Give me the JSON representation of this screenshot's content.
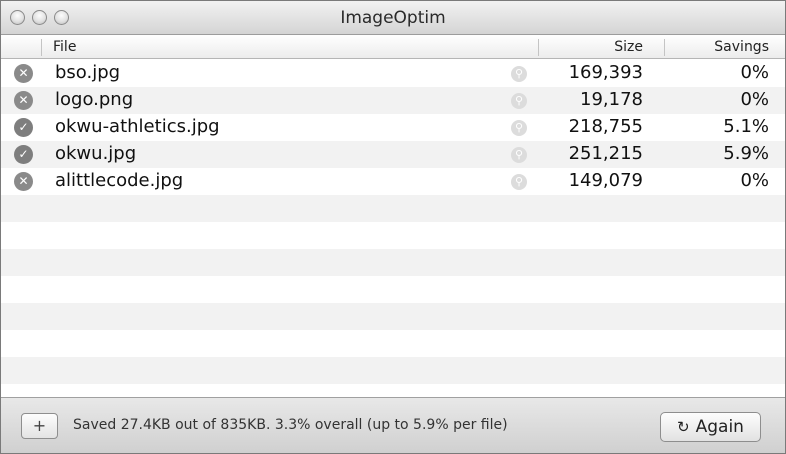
{
  "window": {
    "title": "ImageOptim"
  },
  "columns": {
    "file": "File",
    "size": "Size",
    "savings": "Savings"
  },
  "files": [
    {
      "name": "bso.jpg",
      "size": "169,393",
      "savings": "0%",
      "status": "error"
    },
    {
      "name": "logo.png",
      "size": "19,178",
      "savings": "0%",
      "status": "error"
    },
    {
      "name": "okwu-athletics.jpg",
      "size": "218,755",
      "savings": "5.1%",
      "status": "ok"
    },
    {
      "name": "okwu.jpg",
      "size": "251,215",
      "savings": "5.9%",
      "status": "ok"
    },
    {
      "name": "alittlecode.jpg",
      "size": "149,079",
      "savings": "0%",
      "status": "error"
    }
  ],
  "footer": {
    "add_label": "+",
    "status": "Saved 27.4KB out of 835KB. 3.3% overall (up to 5.9% per file)",
    "again_label": "Again"
  },
  "icons": {
    "close": "close-icon",
    "minimize": "minimize-icon",
    "zoom": "zoom-icon",
    "error": "x-circle-icon",
    "ok": "checkmark-circle-icon",
    "preview": "magnifier-icon",
    "again": "refresh-icon"
  }
}
